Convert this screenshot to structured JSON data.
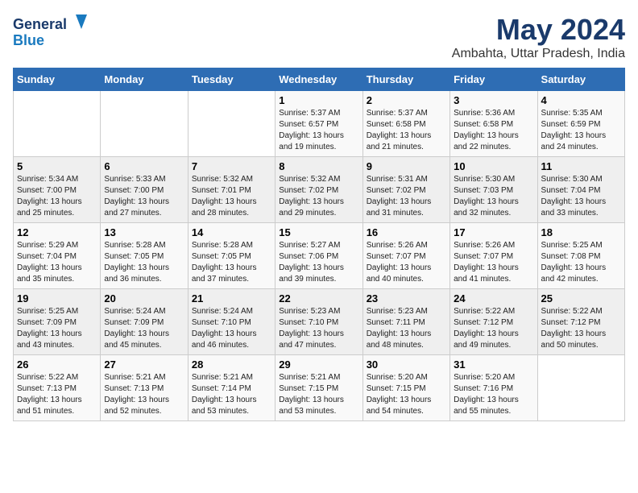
{
  "logo": {
    "line1": "General",
    "line2": "Blue"
  },
  "title": "May 2024",
  "subtitle": "Ambahta, Uttar Pradesh, India",
  "weekdays": [
    "Sunday",
    "Monday",
    "Tuesday",
    "Wednesday",
    "Thursday",
    "Friday",
    "Saturday"
  ],
  "weeks": [
    [
      null,
      null,
      null,
      {
        "day": "1",
        "sunrise": "5:37 AM",
        "sunset": "6:57 PM",
        "daylight": "13 hours and 19 minutes."
      },
      {
        "day": "2",
        "sunrise": "5:37 AM",
        "sunset": "6:58 PM",
        "daylight": "13 hours and 21 minutes."
      },
      {
        "day": "3",
        "sunrise": "5:36 AM",
        "sunset": "6:58 PM",
        "daylight": "13 hours and 22 minutes."
      },
      {
        "day": "4",
        "sunrise": "5:35 AM",
        "sunset": "6:59 PM",
        "daylight": "13 hours and 24 minutes."
      }
    ],
    [
      {
        "day": "5",
        "sunrise": "5:34 AM",
        "sunset": "7:00 PM",
        "daylight": "13 hours and 25 minutes."
      },
      {
        "day": "6",
        "sunrise": "5:33 AM",
        "sunset": "7:00 PM",
        "daylight": "13 hours and 27 minutes."
      },
      {
        "day": "7",
        "sunrise": "5:32 AM",
        "sunset": "7:01 PM",
        "daylight": "13 hours and 28 minutes."
      },
      {
        "day": "8",
        "sunrise": "5:32 AM",
        "sunset": "7:02 PM",
        "daylight": "13 hours and 29 minutes."
      },
      {
        "day": "9",
        "sunrise": "5:31 AM",
        "sunset": "7:02 PM",
        "daylight": "13 hours and 31 minutes."
      },
      {
        "day": "10",
        "sunrise": "5:30 AM",
        "sunset": "7:03 PM",
        "daylight": "13 hours and 32 minutes."
      },
      {
        "day": "11",
        "sunrise": "5:30 AM",
        "sunset": "7:04 PM",
        "daylight": "13 hours and 33 minutes."
      }
    ],
    [
      {
        "day": "12",
        "sunrise": "5:29 AM",
        "sunset": "7:04 PM",
        "daylight": "13 hours and 35 minutes."
      },
      {
        "day": "13",
        "sunrise": "5:28 AM",
        "sunset": "7:05 PM",
        "daylight": "13 hours and 36 minutes."
      },
      {
        "day": "14",
        "sunrise": "5:28 AM",
        "sunset": "7:05 PM",
        "daylight": "13 hours and 37 minutes."
      },
      {
        "day": "15",
        "sunrise": "5:27 AM",
        "sunset": "7:06 PM",
        "daylight": "13 hours and 39 minutes."
      },
      {
        "day": "16",
        "sunrise": "5:26 AM",
        "sunset": "7:07 PM",
        "daylight": "13 hours and 40 minutes."
      },
      {
        "day": "17",
        "sunrise": "5:26 AM",
        "sunset": "7:07 PM",
        "daylight": "13 hours and 41 minutes."
      },
      {
        "day": "18",
        "sunrise": "5:25 AM",
        "sunset": "7:08 PM",
        "daylight": "13 hours and 42 minutes."
      }
    ],
    [
      {
        "day": "19",
        "sunrise": "5:25 AM",
        "sunset": "7:09 PM",
        "daylight": "13 hours and 43 minutes."
      },
      {
        "day": "20",
        "sunrise": "5:24 AM",
        "sunset": "7:09 PM",
        "daylight": "13 hours and 45 minutes."
      },
      {
        "day": "21",
        "sunrise": "5:24 AM",
        "sunset": "7:10 PM",
        "daylight": "13 hours and 46 minutes."
      },
      {
        "day": "22",
        "sunrise": "5:23 AM",
        "sunset": "7:10 PM",
        "daylight": "13 hours and 47 minutes."
      },
      {
        "day": "23",
        "sunrise": "5:23 AM",
        "sunset": "7:11 PM",
        "daylight": "13 hours and 48 minutes."
      },
      {
        "day": "24",
        "sunrise": "5:22 AM",
        "sunset": "7:12 PM",
        "daylight": "13 hours and 49 minutes."
      },
      {
        "day": "25",
        "sunrise": "5:22 AM",
        "sunset": "7:12 PM",
        "daylight": "13 hours and 50 minutes."
      }
    ],
    [
      {
        "day": "26",
        "sunrise": "5:22 AM",
        "sunset": "7:13 PM",
        "daylight": "13 hours and 51 minutes."
      },
      {
        "day": "27",
        "sunrise": "5:21 AM",
        "sunset": "7:13 PM",
        "daylight": "13 hours and 52 minutes."
      },
      {
        "day": "28",
        "sunrise": "5:21 AM",
        "sunset": "7:14 PM",
        "daylight": "13 hours and 53 minutes."
      },
      {
        "day": "29",
        "sunrise": "5:21 AM",
        "sunset": "7:15 PM",
        "daylight": "13 hours and 53 minutes."
      },
      {
        "day": "30",
        "sunrise": "5:20 AM",
        "sunset": "7:15 PM",
        "daylight": "13 hours and 54 minutes."
      },
      {
        "day": "31",
        "sunrise": "5:20 AM",
        "sunset": "7:16 PM",
        "daylight": "13 hours and 55 minutes."
      },
      null
    ]
  ]
}
